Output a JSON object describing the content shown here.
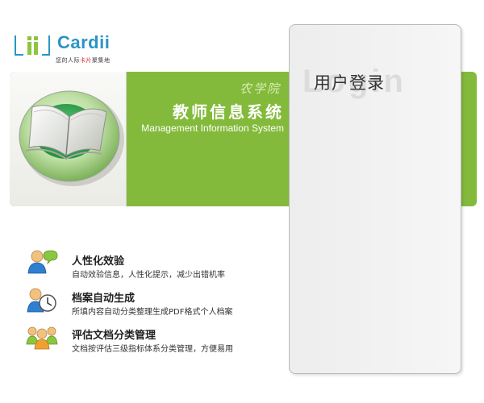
{
  "logo": {
    "name": "Cardii",
    "tagline_lead": "您的人际",
    "tagline_accent": "卡片",
    "tagline_tail": "聚集地"
  },
  "banner": {
    "college": "农学院",
    "title": "教师信息系统",
    "subtitle": "Management Information System"
  },
  "login": {
    "title": "用户登录",
    "watermark": "Login"
  },
  "features": [
    {
      "icon": "users-chat-icon",
      "title": "人性化效验",
      "desc": "自动效验信息，人性化提示，减少出错机率"
    },
    {
      "icon": "clock-archive-icon",
      "title": "档案自动生成",
      "desc": "所填内容自动分类整理生成PDF格式个人档案"
    },
    {
      "icon": "group-users-icon",
      "title": "评估文档分类管理",
      "desc": "文档按评估三级指标体系分类管理，方便易用"
    }
  ],
  "colors": {
    "brand_green": "#84ba3b",
    "logo_blue": "#2a95c4"
  }
}
